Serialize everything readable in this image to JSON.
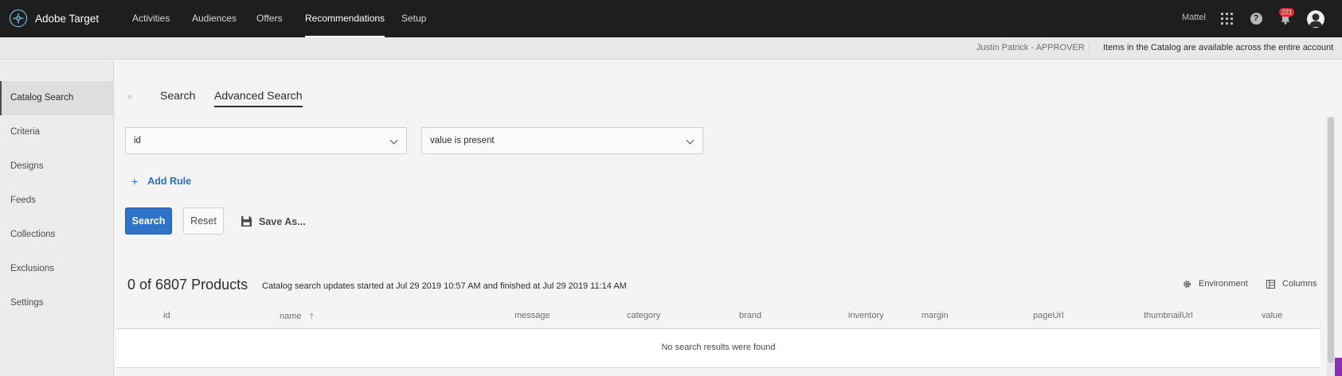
{
  "app": {
    "name": "Adobe Target"
  },
  "nav": {
    "items": [
      "Activities",
      "Audiences",
      "Offers",
      "Recommendations",
      "Setup"
    ],
    "active": "Recommendations"
  },
  "topbar": {
    "org": "Mattel",
    "notifications": "221"
  },
  "subbar": {
    "user": "Justin Patrick - APPROVER",
    "note": "Items in the Catalog are available across the entire account"
  },
  "sidebar": {
    "items": [
      "Catalog Search",
      "Criteria",
      "Designs",
      "Feeds",
      "Collections",
      "Exclusions",
      "Settings"
    ],
    "active": "Catalog Search"
  },
  "tabs": {
    "search": "Search",
    "advanced": "Advanced Search"
  },
  "rule": {
    "attribute": "id",
    "operator": "value is present"
  },
  "actions": {
    "add_rule": "Add Rule",
    "search": "Search",
    "reset": "Reset",
    "save_as": "Save As..."
  },
  "results": {
    "count_label": "0 of 6807 Products",
    "update_note": "Catalog search updates started at Jul 29 2019 10:57 AM and finished at Jul 29 2019 11:14 AM",
    "environment_label": "Environment",
    "columns_label": "Columns",
    "columns": [
      "id",
      "name",
      "message",
      "category",
      "brand",
      "inventory",
      "margin",
      "pageUrl",
      "thumbnailUrl",
      "value"
    ],
    "empty_message": "No search results were found"
  },
  "colors": {
    "topbar_bg": "#1e1e1e",
    "primary": "#2d73c9",
    "link": "#2d6fc4",
    "badge": "#e12e2e"
  }
}
